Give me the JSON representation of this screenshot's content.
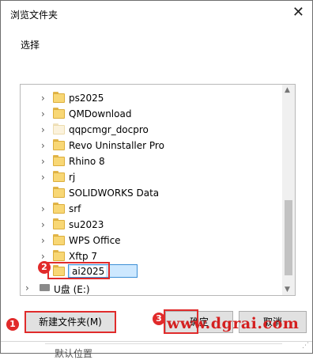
{
  "window": {
    "title": "浏览文件夹",
    "close_glyph": "✕"
  },
  "description": "选择",
  "tree": {
    "items": [
      {
        "label": "ps2025",
        "icon": "folder-icon",
        "pale": false
      },
      {
        "label": "QMDownload",
        "icon": "folder-icon",
        "pale": false
      },
      {
        "label": "qqpcmgr_docpro",
        "icon": "folder-icon",
        "pale": true
      },
      {
        "label": "Revo Uninstaller Pro",
        "icon": "folder-icon",
        "pale": false
      },
      {
        "label": "Rhino 8",
        "icon": "folder-icon",
        "pale": false
      },
      {
        "label": "rj",
        "icon": "folder-icon",
        "pale": false
      },
      {
        "label": "SOLIDWORKS Data",
        "icon": "folder-icon",
        "pale": false
      },
      {
        "label": "srf",
        "icon": "folder-icon",
        "pale": false
      },
      {
        "label": "su2023",
        "icon": "folder-icon",
        "pale": false
      },
      {
        "label": "WPS Office",
        "icon": "folder-icon",
        "pale": false
      },
      {
        "label": "Xftp 7",
        "icon": "folder-icon",
        "pale": false
      }
    ],
    "editing": {
      "value": "ai2025"
    },
    "drive": {
      "label": "U盘 (E:)",
      "icon": "drive-icon"
    }
  },
  "buttons": {
    "new_folder": "新建文件夹(M)",
    "ok": "确定",
    "cancel": "取消"
  },
  "annotations": {
    "a1": "1",
    "a2": "2",
    "a3": "3"
  },
  "watermark": "www.dgrai.com",
  "footer_peek": "默认位置",
  "colors": {
    "highlight": "#e02b2b",
    "folder": "#f8d775",
    "selection": "#cde8ff"
  }
}
